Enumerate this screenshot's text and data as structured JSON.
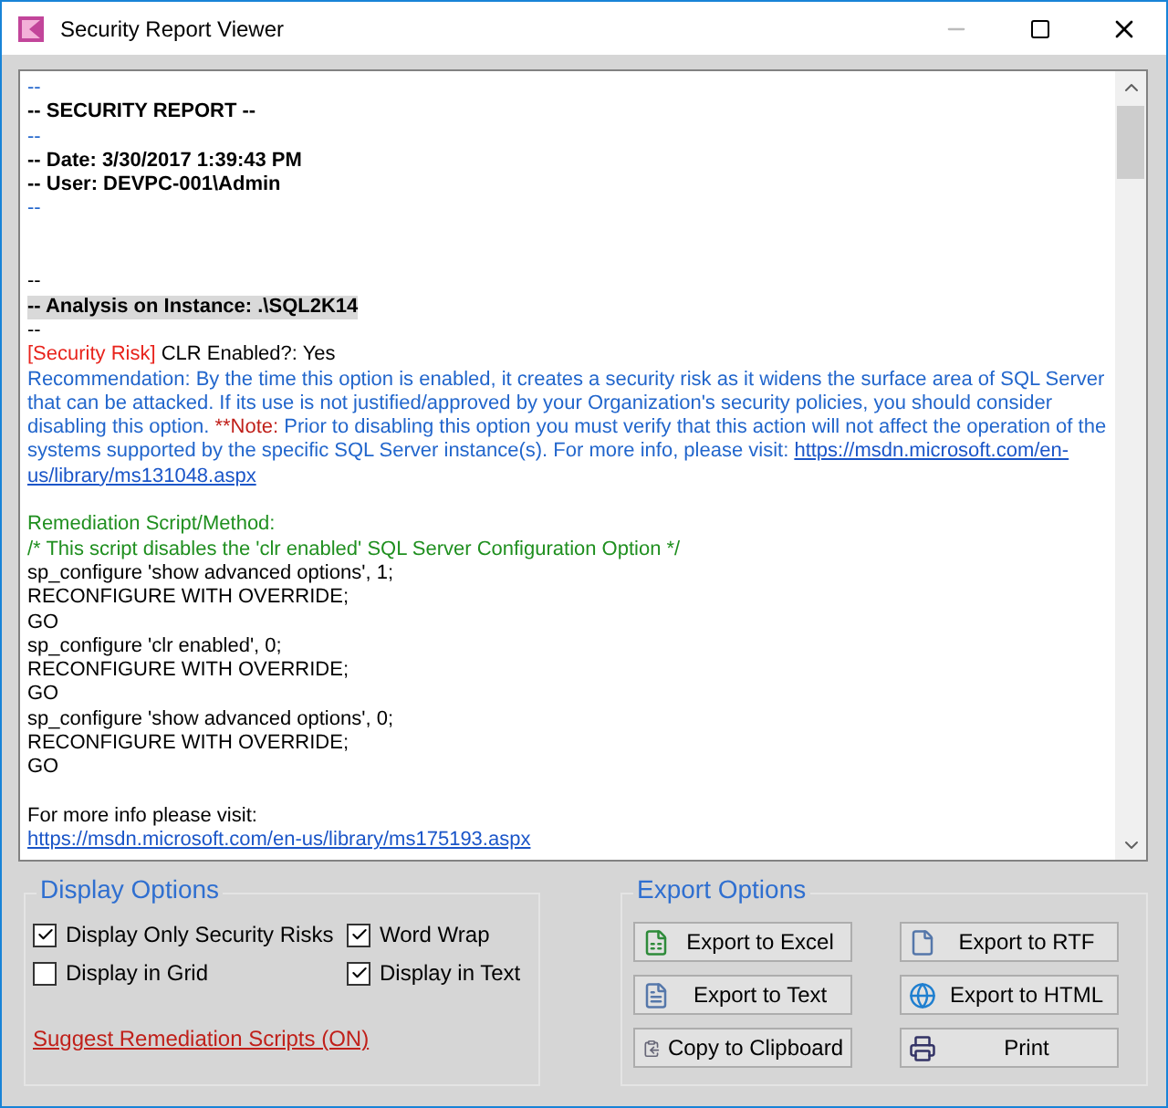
{
  "window": {
    "title": "Security Report Viewer"
  },
  "report": {
    "lines": [
      {
        "kind": "text",
        "segments": [
          {
            "kind": "comment",
            "text": "--"
          }
        ]
      },
      {
        "kind": "text",
        "segments": [
          {
            "kind": "bold",
            "text": "-- SECURITY REPORT --"
          }
        ]
      },
      {
        "kind": "text",
        "segments": [
          {
            "kind": "comment",
            "text": "--"
          }
        ]
      },
      {
        "kind": "text",
        "segments": [
          {
            "kind": "bold",
            "text": "-- Date: 3/30/2017 1:39:43 PM"
          }
        ]
      },
      {
        "kind": "text",
        "segments": [
          {
            "kind": "bold",
            "text": "-- User: DEVPC-001\\Admin"
          }
        ]
      },
      {
        "kind": "text",
        "segments": [
          {
            "kind": "comment",
            "text": "--"
          }
        ]
      },
      {
        "kind": "blank"
      },
      {
        "kind": "blank"
      },
      {
        "kind": "text",
        "segments": [
          {
            "kind": "plain",
            "text": "--"
          }
        ]
      },
      {
        "kind": "text",
        "highlighted": true,
        "segments": [
          {
            "kind": "bold",
            "text": "-- Analysis on Instance: .\\SQL2K14"
          }
        ]
      },
      {
        "kind": "text",
        "segments": [
          {
            "kind": "plain",
            "text": "--"
          }
        ]
      },
      {
        "kind": "text",
        "segments": [
          {
            "kind": "risk",
            "text": "[Security Risk]"
          },
          {
            "kind": "plain",
            "text": " CLR Enabled?: Yes"
          }
        ]
      },
      {
        "kind": "text",
        "segments": [
          {
            "kind": "comment",
            "text": "Recommendation: By the time this option is enabled, it creates a security risk as it widens the surface area of SQL Server that can be attacked. If its use is not justified/approved by your Organization's security policies, you should consider disabling this option. "
          },
          {
            "kind": "note",
            "text": "**Note:"
          },
          {
            "kind": "comment",
            "text": " Prior to disabling this option you must verify that this action will not affect the operation of the systems supported by the specific SQL Server instance(s). For more info, please visit: "
          },
          {
            "kind": "link",
            "text": "https://msdn.microsoft.com/en-"
          }
        ]
      },
      {
        "kind": "text",
        "segments": [
          {
            "kind": "link",
            "text": "us/library/ms131048.aspx"
          }
        ]
      },
      {
        "kind": "blank"
      },
      {
        "kind": "text",
        "segments": [
          {
            "kind": "green",
            "text": "Remediation Script/Method:"
          }
        ]
      },
      {
        "kind": "text",
        "segments": [
          {
            "kind": "green",
            "text": "/* This script disables the 'clr enabled' SQL Server Configuration Option */"
          }
        ]
      },
      {
        "kind": "text",
        "segments": [
          {
            "kind": "plain",
            "text": "sp_configure 'show advanced options', 1;"
          }
        ]
      },
      {
        "kind": "text",
        "segments": [
          {
            "kind": "plain",
            "text": "RECONFIGURE WITH OVERRIDE;"
          }
        ]
      },
      {
        "kind": "text",
        "segments": [
          {
            "kind": "plain",
            "text": "GO"
          }
        ]
      },
      {
        "kind": "text",
        "segments": [
          {
            "kind": "plain",
            "text": "sp_configure 'clr enabled', 0;"
          }
        ]
      },
      {
        "kind": "text",
        "segments": [
          {
            "kind": "plain",
            "text": "RECONFIGURE WITH OVERRIDE;"
          }
        ]
      },
      {
        "kind": "text",
        "segments": [
          {
            "kind": "plain",
            "text": "GO"
          }
        ]
      },
      {
        "kind": "text",
        "segments": [
          {
            "kind": "plain",
            "text": "sp_configure 'show advanced options', 0;"
          }
        ]
      },
      {
        "kind": "text",
        "segments": [
          {
            "kind": "plain",
            "text": "RECONFIGURE WITH OVERRIDE;"
          }
        ]
      },
      {
        "kind": "text",
        "segments": [
          {
            "kind": "plain",
            "text": "GO"
          }
        ]
      },
      {
        "kind": "blank"
      },
      {
        "kind": "text",
        "segments": [
          {
            "kind": "plain",
            "text": "For more info please visit:"
          }
        ]
      },
      {
        "kind": "text",
        "segments": [
          {
            "kind": "link",
            "text": "https://msdn.microsoft.com/en-us/library/ms175193.aspx"
          }
        ]
      }
    ]
  },
  "display_options": {
    "title": "Display Options",
    "checkboxes": [
      {
        "label": "Display Only Security Risks",
        "checked": true
      },
      {
        "label": "Word Wrap",
        "checked": true
      },
      {
        "label": "Display in Grid",
        "checked": false
      },
      {
        "label": "Display in Text",
        "checked": true
      }
    ],
    "link": "Suggest Remediation Scripts (ON)"
  },
  "export_options": {
    "title": "Export Options",
    "buttons": [
      {
        "label": "Export to Excel",
        "kind": "excel"
      },
      {
        "label": "Export to RTF",
        "kind": "rtf"
      },
      {
        "label": "Export to Text",
        "kind": "text"
      },
      {
        "label": "Export to HTML",
        "kind": "html"
      },
      {
        "label": "Copy to Clipboard",
        "kind": "clipboard"
      },
      {
        "label": "Print",
        "kind": "print"
      }
    ]
  }
}
